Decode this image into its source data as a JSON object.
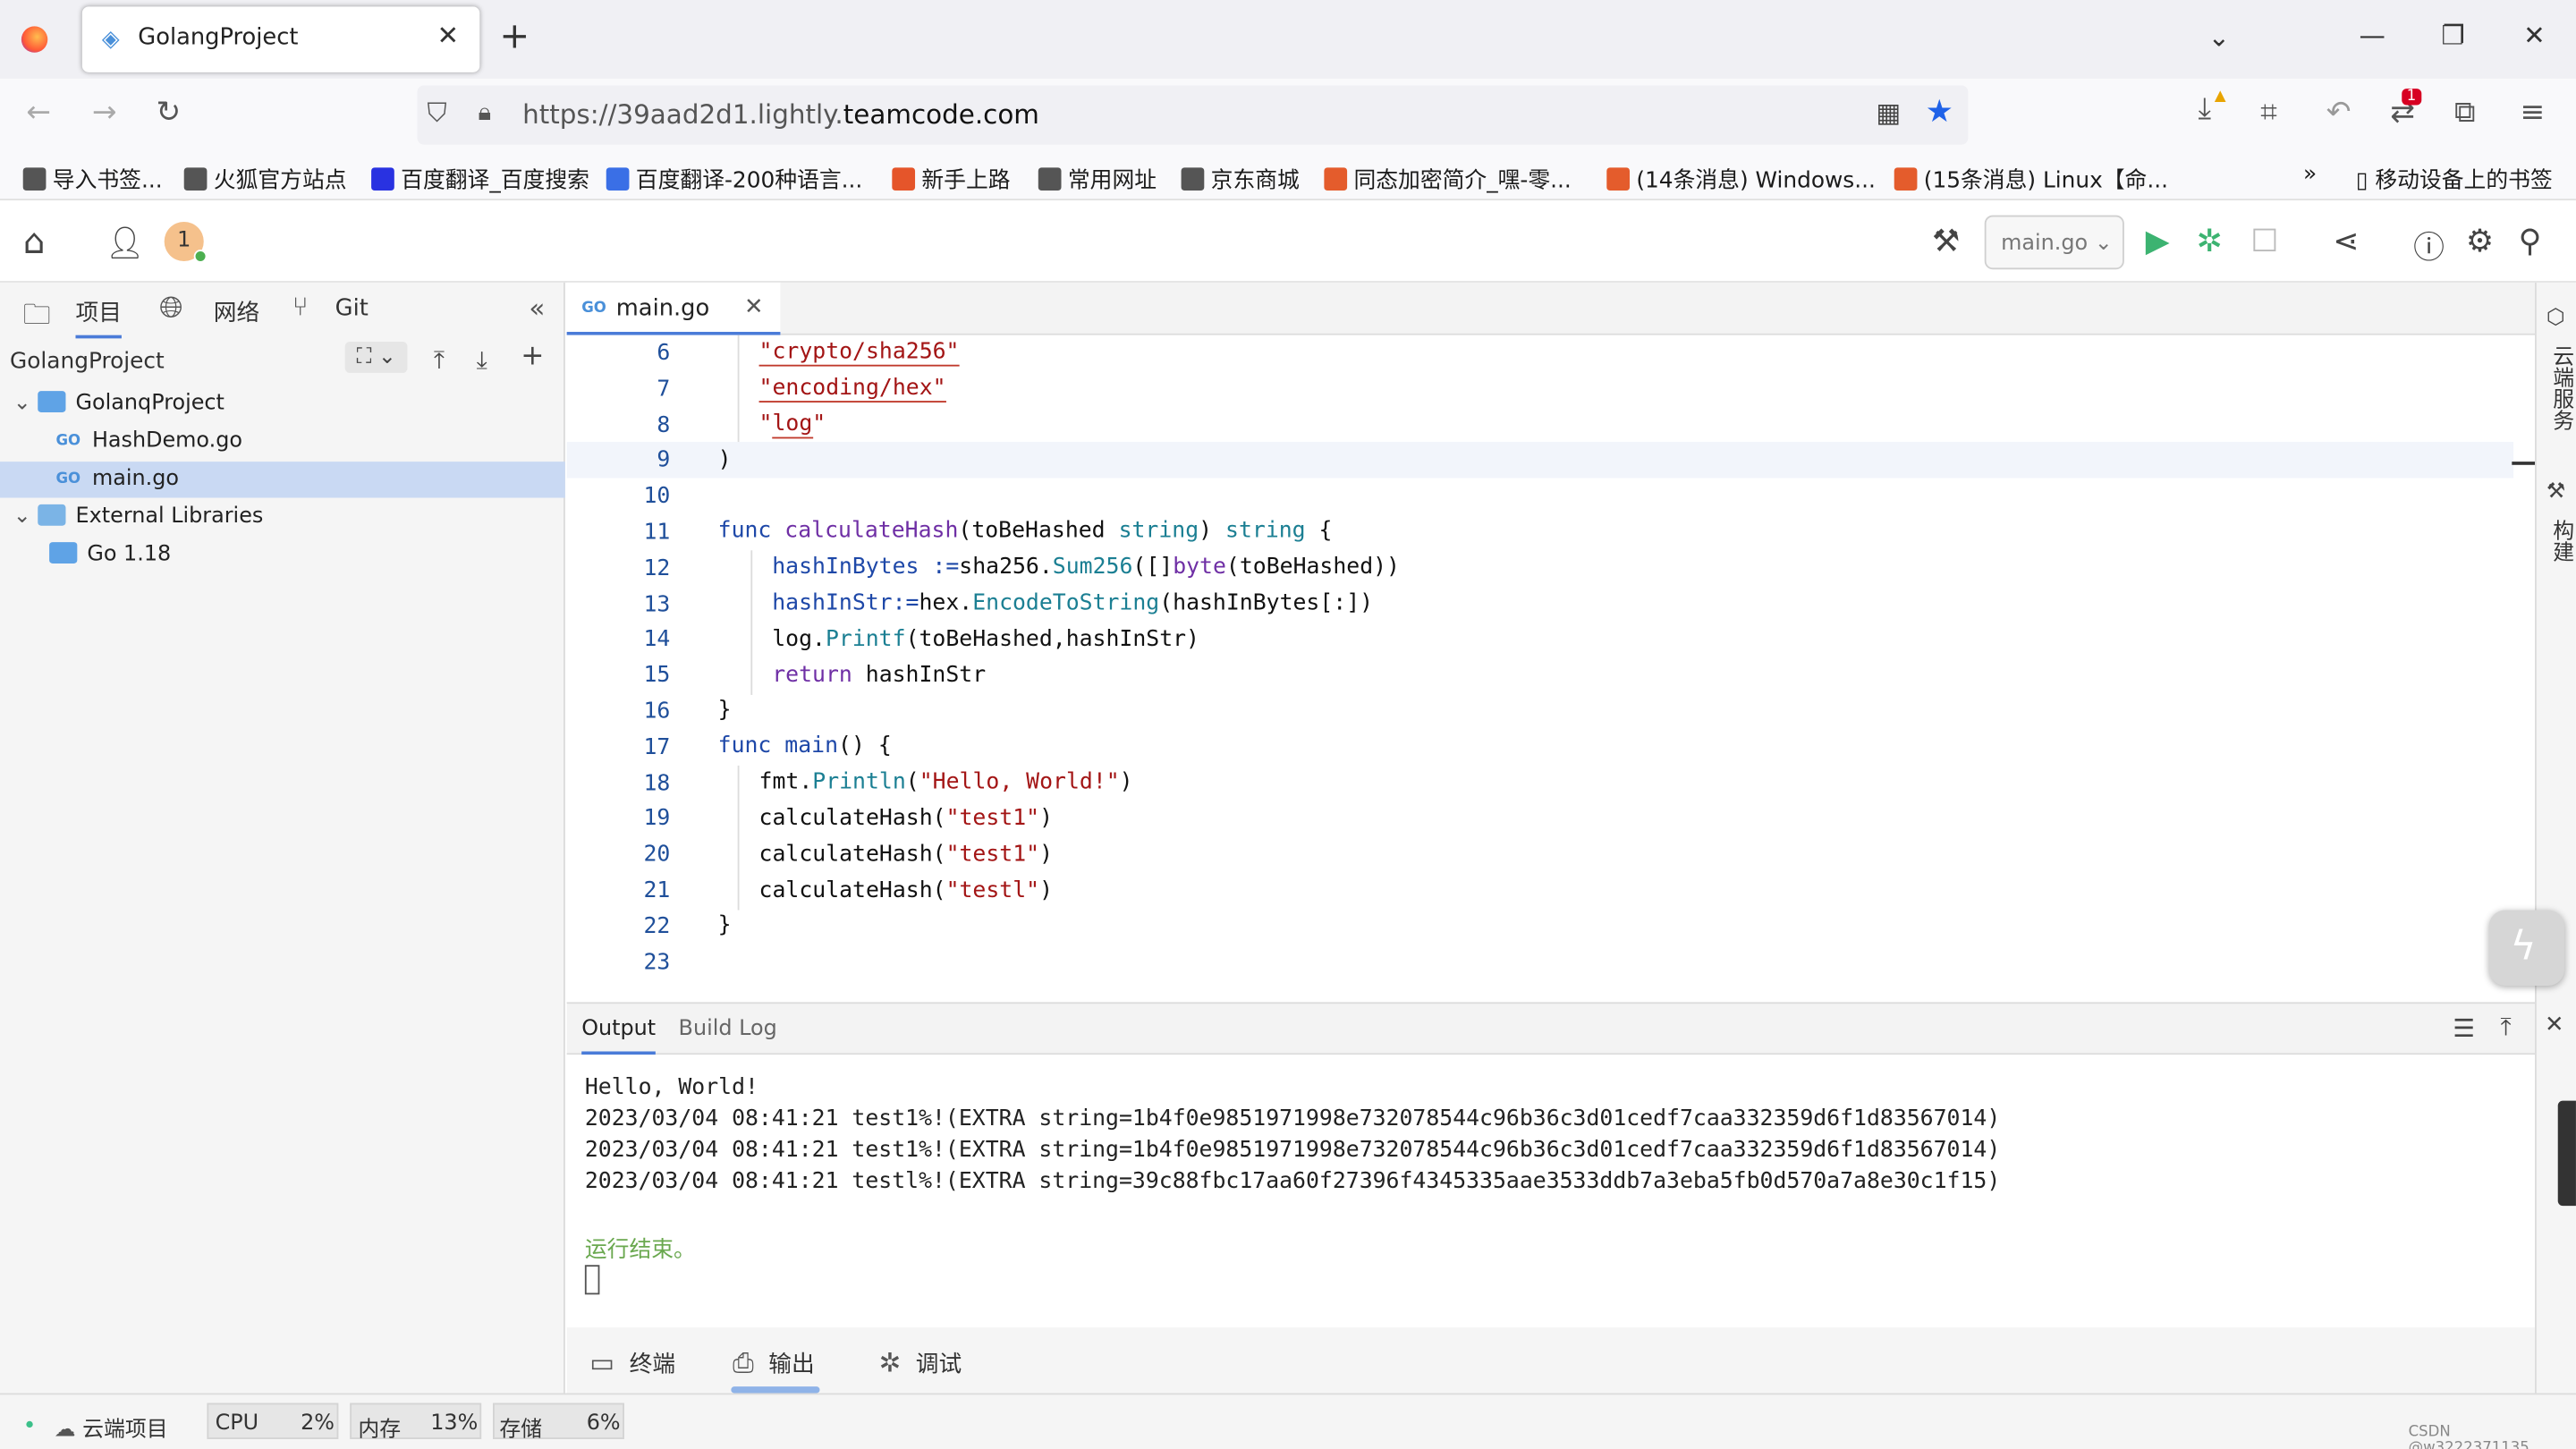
{
  "browser": {
    "tab_title": "GolangProject",
    "url_prefix": "https://39aad2d1.lightly.",
    "url_domain": "teamcode.com",
    "notif_count": "1",
    "bookmarks": [
      {
        "label": "导入书签...",
        "color": "#555"
      },
      {
        "label": "火狐官方站点",
        "color": "#555"
      },
      {
        "label": "百度翻译_百度搜索",
        "color": "#2932e1"
      },
      {
        "label": "百度翻译-200种语言...",
        "color": "#3a6fe6"
      },
      {
        "label": "新手上路",
        "color": "#e5552a"
      },
      {
        "label": "常用网址",
        "color": "#555"
      },
      {
        "label": "京东商城",
        "color": "#555"
      },
      {
        "label": "同态加密简介_嘿-零...",
        "color": "#e45c2c"
      },
      {
        "label": "(14条消息) Windows...",
        "color": "#e45c2c"
      },
      {
        "label": "(15条消息) Linux【命...",
        "color": "#e45c2c"
      }
    ],
    "mobile_bookmarks": "移动设备上的书签"
  },
  "ide": {
    "user_badge": "1",
    "run_config": "main.go",
    "left_tabs": [
      "项目",
      "网络",
      "Git"
    ],
    "project_name": "GolangProject",
    "tree": [
      {
        "label": "GolanqProject",
        "kind": "folder",
        "indent": 0
      },
      {
        "label": "HashDemo.go",
        "kind": "go",
        "indent": 1
      },
      {
        "label": "main.go",
        "kind": "go",
        "indent": 1,
        "selected": true
      },
      {
        "label": "External Libraries",
        "kind": "lib",
        "indent": 0
      },
      {
        "label": "Go 1.18",
        "kind": "folder",
        "indent": 1
      }
    ],
    "editor_tab": "main.go",
    "line_numbers": [
      "6",
      "7",
      "8",
      "9",
      "10",
      "11",
      "12",
      "13",
      "14",
      "15",
      "16",
      "17",
      "18",
      "19",
      "20",
      "21",
      "22",
      "23"
    ],
    "right_sidebar": [
      "云端服务",
      "构建"
    ],
    "output_tabs": [
      "Output",
      "Build Log"
    ],
    "output_lines": [
      "Hello, World!",
      "2023/03/04 08:41:21 test1%!(EXTRA string=1b4f0e9851971998e732078544c96b36c3d01cedf7caa332359d6f1d83567014)",
      "2023/03/04 08:41:21 test1%!(EXTRA string=1b4f0e9851971998e732078544c96b36c3d01cedf7caa332359d6f1d83567014)",
      "2023/03/04 08:41:21 testl%!(EXTRA string=39c88fbc17aa60f27396f4345335aae3533ddb7a3eba5fb0d570a7a8e30c1f15)"
    ],
    "run_finished": "运行结束。",
    "bottom_tabs": [
      "终端",
      "输出",
      "调试"
    ],
    "status": {
      "cloud_project": "云端项目",
      "cpu_label": "CPU",
      "cpu_value": "2%",
      "mem_label": "内存",
      "mem_value": "13%",
      "disk_label": "存储",
      "disk_value": "6%",
      "watermark": "CSDN @w3222371135"
    }
  }
}
